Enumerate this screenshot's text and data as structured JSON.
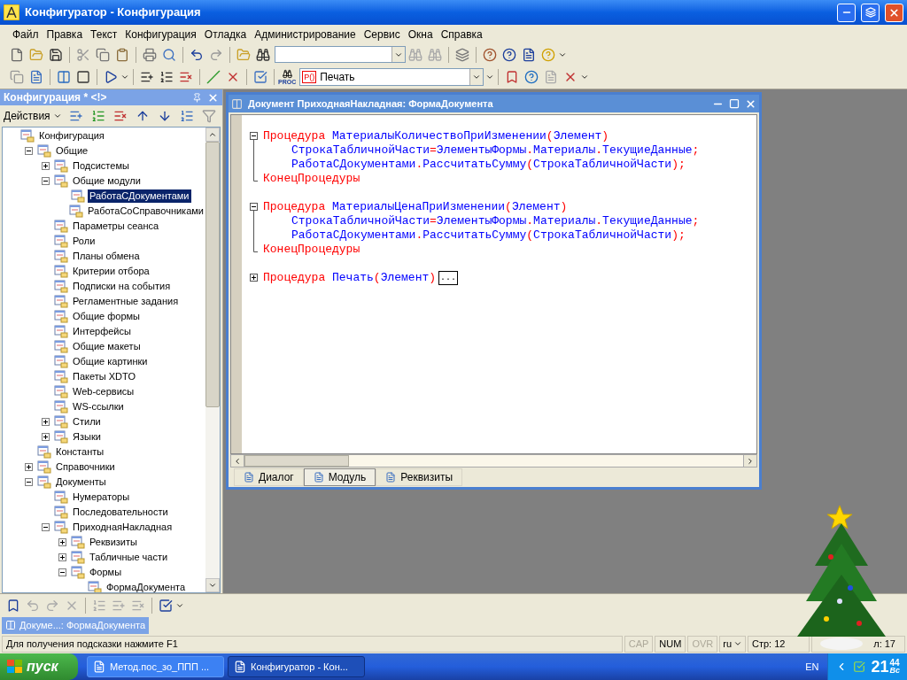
{
  "window": {
    "title": "Конфигуратор - Конфигурация"
  },
  "menu": [
    "Файл",
    "Правка",
    "Текст",
    "Конфигурация",
    "Отладка",
    "Администрирование",
    "Сервис",
    "Окна",
    "Справка"
  ],
  "toolbar": {
    "proc_label": "PROC",
    "combo_badge": "P()",
    "combo_value": "Печать"
  },
  "panel": {
    "title": "Конфигурация * <!>",
    "actions": "Действия"
  },
  "tree": [
    {
      "label": "Конфигурация",
      "selected": false,
      "children": [
        {
          "label": "Общие",
          "expanded": true,
          "selected": false,
          "children": [
            {
              "label": "Подсистемы",
              "expanded": false,
              "selected": false
            },
            {
              "label": "Общие модули",
              "expanded": true,
              "selected": false,
              "children": [
                {
                  "label": "РаботаСДокументами",
                  "selected": true
                },
                {
                  "label": "РаботаСоСправочниками",
                  "selected": false
                }
              ]
            },
            {
              "label": "Параметры сеанса",
              "selected": false
            },
            {
              "label": "Роли",
              "selected": false
            },
            {
              "label": "Планы обмена",
              "selected": false
            },
            {
              "label": "Критерии отбора",
              "selected": false
            },
            {
              "label": "Подписки на события",
              "selected": false
            },
            {
              "label": "Регламентные задания",
              "selected": false
            },
            {
              "label": "Общие формы",
              "selected": false
            },
            {
              "label": "Интерфейсы",
              "selected": false
            },
            {
              "label": "Общие макеты",
              "selected": false
            },
            {
              "label": "Общие картинки",
              "selected": false
            },
            {
              "label": "Пакеты XDTO",
              "selected": false
            },
            {
              "label": "Web-сервисы",
              "selected": false
            },
            {
              "label": "WS-ссылки",
              "selected": false
            },
            {
              "label": "Стили",
              "expanded": false,
              "selected": false
            },
            {
              "label": "Языки",
              "expanded": false,
              "selected": false
            }
          ]
        },
        {
          "label": "Константы",
          "selected": false
        },
        {
          "label": "Справочники",
          "expanded": false,
          "selected": false
        },
        {
          "label": "Документы",
          "expanded": true,
          "selected": false,
          "children": [
            {
              "label": "Нумераторы",
              "selected": false
            },
            {
              "label": "Последовательности",
              "selected": false
            },
            {
              "label": "ПриходнаяНакладная",
              "expanded": true,
              "selected": false,
              "children": [
                {
                  "label": "Реквизиты",
                  "expanded": false,
                  "selected": false
                },
                {
                  "label": "Табличные части",
                  "expanded": false,
                  "selected": false
                },
                {
                  "label": "Формы",
                  "expanded": true,
                  "selected": false,
                  "children": [
                    {
                      "label": "ФормаДокумента",
                      "selected": false
                    }
                  ]
                }
              ]
            }
          ]
        }
      ]
    }
  ],
  "editor": {
    "title": "Документ ПриходнаяНакладная: ФормаДокумента",
    "lines": [
      {
        "kind": "start",
        "tokens": [
          {
            "kind": "kw",
            "text": "Процедура "
          },
          {
            "kind": "id",
            "text": "МатериалыКоличествоПриИзменении"
          },
          {
            "kind": "op",
            "text": "("
          },
          {
            "kind": "id",
            "text": "Элемент"
          },
          {
            "kind": "op",
            "text": ")"
          }
        ]
      },
      {
        "kind": "body",
        "tokens": [
          {
            "kind": "id",
            "text": "СтрокаТабличнойЧасти"
          },
          {
            "kind": "op",
            "text": "="
          },
          {
            "kind": "id",
            "text": "ЭлементыФормы"
          },
          {
            "kind": "op",
            "text": "."
          },
          {
            "kind": "id",
            "text": "Материалы"
          },
          {
            "kind": "op",
            "text": "."
          },
          {
            "kind": "id",
            "text": "ТекущиеДанные"
          },
          {
            "kind": "op",
            "text": ";"
          }
        ]
      },
      {
        "kind": "body",
        "tokens": [
          {
            "kind": "id",
            "text": "РаботаСДокументами"
          },
          {
            "kind": "op",
            "text": "."
          },
          {
            "kind": "id",
            "text": "РассчитатьСумму"
          },
          {
            "kind": "op",
            "text": "("
          },
          {
            "kind": "id",
            "text": "СтрокаТабличнойЧасти"
          },
          {
            "kind": "op",
            "text": ")"
          },
          {
            "kind": "op",
            "text": ";"
          }
        ]
      },
      {
        "kind": "end",
        "tokens": [
          {
            "kind": "kw",
            "text": "КонецПроцедуры"
          }
        ]
      },
      {
        "kind": "blank"
      },
      {
        "kind": "start",
        "tokens": [
          {
            "kind": "kw",
            "text": "Процедура "
          },
          {
            "kind": "id",
            "text": "МатериалыЦенаПриИзменении"
          },
          {
            "kind": "op",
            "text": "("
          },
          {
            "kind": "id",
            "text": "Элемент"
          },
          {
            "kind": "op",
            "text": ")"
          }
        ]
      },
      {
        "kind": "body",
        "tokens": [
          {
            "kind": "id",
            "text": "СтрокаТабличнойЧасти"
          },
          {
            "kind": "op",
            "text": "="
          },
          {
            "kind": "id",
            "text": "ЭлементыФормы"
          },
          {
            "kind": "op",
            "text": "."
          },
          {
            "kind": "id",
            "text": "Материалы"
          },
          {
            "kind": "op",
            "text": "."
          },
          {
            "kind": "id",
            "text": "ТекущиеДанные"
          },
          {
            "kind": "op",
            "text": ";"
          }
        ]
      },
      {
        "kind": "body",
        "tokens": [
          {
            "kind": "id",
            "text": "РаботаСДокументами"
          },
          {
            "kind": "op",
            "text": "."
          },
          {
            "kind": "id",
            "text": "РассчитатьСумму"
          },
          {
            "kind": "op",
            "text": "("
          },
          {
            "kind": "id",
            "text": "СтрокаТабличнойЧасти"
          },
          {
            "kind": "op",
            "text": ")"
          },
          {
            "kind": "op",
            "text": ";"
          }
        ]
      },
      {
        "kind": "end",
        "tokens": [
          {
            "kind": "kw",
            "text": "КонецПроцедуры"
          }
        ]
      },
      {
        "kind": "blank"
      },
      {
        "kind": "collapsed",
        "tokens": [
          {
            "kind": "kw",
            "text": "Процедура "
          },
          {
            "kind": "id",
            "text": "Печать"
          },
          {
            "kind": "op",
            "text": "("
          },
          {
            "kind": "id",
            "text": "Элемент"
          },
          {
            "kind": "op",
            "text": ")"
          },
          {
            "kind": "ellipsis",
            "text": "..."
          }
        ]
      }
    ],
    "tabs": [
      {
        "label": "Диалог",
        "selected": false
      },
      {
        "label": "Модуль",
        "selected": true
      },
      {
        "label": "Реквизиты",
        "selected": false
      }
    ]
  },
  "window_tabs": [
    {
      "label": "Докуме...: ФормаДокумента",
      "selected": true
    }
  ],
  "status_bar": {
    "hint": "Для получения подсказки нажмите F1",
    "indicators": [
      {
        "label": "CAP",
        "on": false
      },
      {
        "label": "NUM",
        "on": true
      },
      {
        "label": "OVR",
        "on": false
      }
    ],
    "language": "ru",
    "line": "Стр: 12",
    "column": "л: 17"
  },
  "taskbar": {
    "start": "пуск",
    "tasks": [
      {
        "label": "Метод.пос_зо_ППП ...",
        "selected": false
      },
      {
        "label": "Конфигуратор - Кон...",
        "selected": true
      }
    ],
    "language": "EN",
    "clock": {
      "hours": "21",
      "minutes": "44",
      "day": "Вс"
    }
  }
}
